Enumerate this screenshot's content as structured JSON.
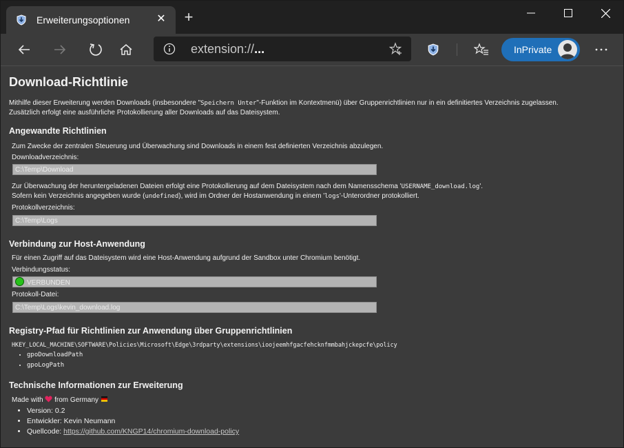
{
  "window": {
    "tab_title": "Erweiterungsoptionen",
    "address": {
      "prefix": "extension://",
      "suffix": "..."
    },
    "inprivate_label": "InPrivate",
    "accent": "#1f6fb8"
  },
  "page": {
    "title": "Download-Richtlinie",
    "intro": {
      "line1_a": "Mithilfe dieser Erweiterung werden Downloads (insbesondere \"",
      "line1_code": "Speichern Unter",
      "line1_b": "\"-Funktion im Kontextmenü) über Gruppenrichtlinien nur in ein definitiertes Verzeichnis zugelassen.",
      "line2": "Zusätzlich erfolgt eine ausführliche Protokollierung aller Downloads auf das Dateisystem."
    },
    "policies": {
      "heading": "Angewandte Richtlinien",
      "desc": "Zum Zwecke der zentralen Steuerung und Überwachung sind Downloads in einem fest definierten Verzeichnis abzulegen.",
      "download_label": "Downloadverzeichnis:",
      "download_value": "C:\\Temp\\Download",
      "log_desc1_a": "Zur Überwachung der heruntergeladenen Dateien erfolgt eine Protokollierung auf dem Dateisystem nach dem Namensschema '",
      "log_desc1_code": "USERNAME_download.log",
      "log_desc1_b": "'.",
      "log_desc2_a": "Sofern kein Verzeichnis angegeben wurde (",
      "log_desc2_code1": "undefined",
      "log_desc2_b": "), wird im Ordner der Hostanwendung in einem '",
      "log_desc2_code2": "logs",
      "log_desc2_c": "'-Unterordner protokolliert.",
      "log_label": "Protokollverzeichnis:",
      "log_value": "C:\\Temp\\Logs"
    },
    "host": {
      "heading": "Verbindung zur Host-Anwendung",
      "desc": "Für einen Zugriff auf das Dateisystem wird eine Host-Anwendung aufgrund der Sandbox unter Chromium benötigt.",
      "status_label": "Verbindungsstatus:",
      "status_value": "VERBUNDEN",
      "status_color": "#27c11a",
      "logfile_label": "Protokoll-Datei:",
      "logfile_value": "C:\\Temp\\Logs\\kevin_download.log"
    },
    "registry": {
      "heading": "Registry-Pfad für Richtlinien zur Anwendung über Gruppenrichtlinien",
      "path": "HKEY_LOCAL_MACHINE\\SOFTWARE\\Policies\\Microsoft\\Edge\\3rdparty\\extensions\\ioojeemhfgacfehcknfmmbahjckepcfe\\policy",
      "items": [
        "gpoDownloadPath",
        "gpoLogPath"
      ]
    },
    "tech": {
      "heading": "Technische Informationen zur Erweiterung",
      "made_a": "Made with",
      "made_b": "from Germany",
      "version": "Version: 0.2",
      "developer": "Entwickler: Kevin Neumann",
      "source_label": "Quellcode:",
      "source_link": "https://github.com/KNGP14/chromium-download-policy"
    }
  }
}
